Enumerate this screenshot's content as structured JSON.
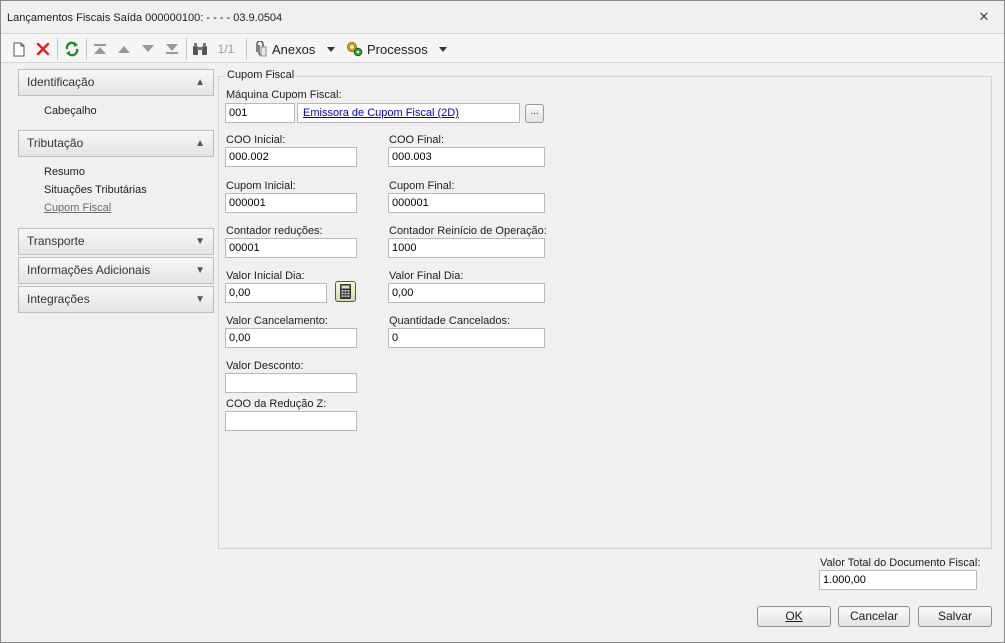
{
  "window": {
    "title": "Lançamentos Fiscais Saída 000000100: - - - - 03.9.0504",
    "close_glyph": "✕"
  },
  "toolbar": {
    "record_counter": "1/1",
    "attachments_label": "Anexos",
    "processes_label": "Processos"
  },
  "nav": {
    "groups": [
      {
        "label": "Identificação",
        "expanded": true,
        "items": [
          "Cabeçalho"
        ]
      },
      {
        "label": "Tributação",
        "expanded": true,
        "items": [
          "Resumo",
          "Situações Tributárias",
          "Cupom Fiscal"
        ]
      },
      {
        "label": "Transporte",
        "expanded": false,
        "items": []
      },
      {
        "label": "Informações Adicionais",
        "expanded": false,
        "items": []
      },
      {
        "label": "Integrações",
        "expanded": false,
        "items": []
      }
    ],
    "active_item": "Cupom Fiscal"
  },
  "form": {
    "section_title": "Cupom Fiscal",
    "maquina": {
      "label": "Máquina Cupom Fiscal:",
      "code": "001",
      "description": "Emissora de Cupom Fiscal (2D)",
      "lookup_label": "..."
    },
    "coo_inicial": {
      "label": "COO Inicial:",
      "value": "000.002"
    },
    "coo_final": {
      "label": "COO Final:",
      "value": "000.003"
    },
    "cupom_inicial": {
      "label": "Cupom Inicial:",
      "value": "000001"
    },
    "cupom_final": {
      "label": "Cupom Final:",
      "value": "000001"
    },
    "contador_reducoes": {
      "label": "Contador reduções:",
      "value": "00001"
    },
    "contador_reinicio": {
      "label": "Contador Reinício de Operação:",
      "value": "1000"
    },
    "valor_inicial_dia": {
      "label": "Valor Inicial Dia:",
      "value": "0,00"
    },
    "valor_final_dia": {
      "label": "Valor Final Dia:",
      "value": "0,00"
    },
    "valor_cancelamento": {
      "label": "Valor Cancelamento:",
      "value": "0,00"
    },
    "quantidade_cancelados": {
      "label": "Quantidade Cancelados:",
      "value": "0"
    },
    "valor_desconto": {
      "label": "Valor Desconto:",
      "value": ""
    },
    "coo_reducao_z": {
      "label": "COO da Redução Z:",
      "value": ""
    }
  },
  "footer": {
    "total_label": "Valor Total do Documento Fiscal:",
    "total_value": "1.000,00",
    "ok_label": "OK",
    "cancel_label": "Cancelar",
    "save_label": "Salvar"
  }
}
